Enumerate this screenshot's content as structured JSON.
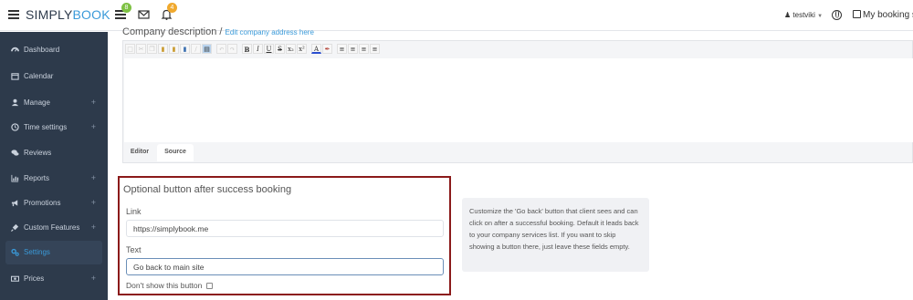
{
  "topbar": {
    "logo_part1": "SIMPLY",
    "logo_part2": "BOOK",
    "tasks_badge": "8",
    "notifications_badge": "4",
    "user_name": "testviki",
    "my_booking_site_label": "My booking s",
    "accent_color": "#3a9ad9",
    "tasks_badge_color": "#7ec143",
    "notifications_badge_color": "#f0a92e"
  },
  "sidebar": {
    "background": "#2d3a4b",
    "items": [
      {
        "label": "Dashboard",
        "icon": "dashboard-icon",
        "has_plus": false
      },
      {
        "label": "Calendar",
        "icon": "calendar-icon",
        "has_plus": false
      },
      {
        "label": "Manage",
        "icon": "user-icon",
        "has_plus": true
      },
      {
        "label": "Time settings",
        "icon": "clock-icon",
        "has_plus": true
      },
      {
        "label": "Reviews",
        "icon": "comments-icon",
        "has_plus": false
      },
      {
        "label": "Reports",
        "icon": "bar-chart-icon",
        "has_plus": true
      },
      {
        "label": "Promotions",
        "icon": "bullhorn-icon",
        "has_plus": true
      },
      {
        "label": "Custom Features",
        "icon": "plug-icon",
        "has_plus": true
      },
      {
        "label": "Settings",
        "icon": "gears-icon",
        "has_plus": false,
        "active": true
      },
      {
        "label": "Prices",
        "icon": "money-icon",
        "has_plus": true
      }
    ],
    "plus_symbol": "+"
  },
  "company_description": {
    "title": "Company description",
    "separator": "/",
    "edit_link": "Edit company address here",
    "tabs": {
      "editor": "Editor",
      "source": "Source"
    }
  },
  "optional_button": {
    "title": "Optional button after success booking",
    "link_label": "Link",
    "link_value": "https://simplybook.me",
    "text_label": "Text",
    "text_value": "Go back to main site",
    "dont_show_label": "Don't show this button",
    "highlight_color": "#8b1a1a"
  },
  "hint": {
    "text": "Customize the 'Go back' button that client sees and can click on after a successful booking. Default it leads back to your company services list. If you want to skip showing a button there, just leave these fields empty."
  }
}
